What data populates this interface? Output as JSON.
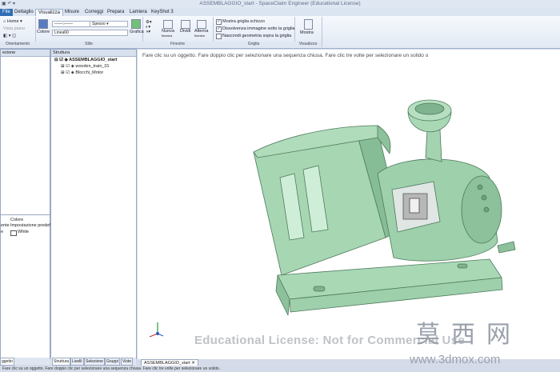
{
  "window": {
    "title": "ASSEMBLAGGIO_start - SpaceClaim Engineer (Educational License)"
  },
  "tabs": [
    "File",
    "Dettaglio",
    "Visualizza",
    "Misure",
    "Correggi",
    "Prepara",
    "Lamiera",
    "KeyShot 3"
  ],
  "ribbon": {
    "orientamento": {
      "label": "Orientamento",
      "home": "Home",
      "vista_piano": "Vista piano"
    },
    "stile": {
      "label": "Stile",
      "colore": "Colore",
      "spesso": "Spesso",
      "linea": "Linea60",
      "grafica": "Grafica"
    },
    "finestre": {
      "label": "Finestre",
      "nuova": "Nuova",
      "nuova_sub": "finestra",
      "dividi": "Dividi",
      "alterna": "Alterna",
      "alterna_sub": "finestre"
    },
    "griglia": {
      "label": "Griglia",
      "opt1": "Mostra griglia schizzo",
      "opt2": "Dissolvenza immagine sotto la griglia",
      "opt3": "Nascondi geometria sopra la griglia"
    },
    "visualizza": {
      "label": "Visualizza",
      "mostra": "Mostra"
    }
  },
  "left_panel": {
    "title": "ezione",
    "props": {
      "col": "Colore",
      "row1_key": "ente",
      "row1_val": "Impostazione predef.",
      "row2_key": "e",
      "row2_val": "White"
    }
  },
  "struttura": {
    "title": "Struttura",
    "root": "ASSEMBLAGGIO_start",
    "items": [
      "wooden_train_01",
      "Blocchi_Motor"
    ]
  },
  "bottom_tabs": [
    "Struttura",
    "Livelli",
    "Selezione",
    "Gruppi",
    "Viste"
  ],
  "left_bottom_tab": "ggetto",
  "doc_tab": "ASSEMBLAGGIO_start",
  "viewport": {
    "prompt": "Fare clic su un oggetto. Fare doppio clic per selezionare una sequenza chiusa. Fare clic tre volte per selezionare un solido o"
  },
  "watermark": {
    "license": "Educational License: Not for Commercial Use",
    "cn": "莫西网",
    "url": "www.3dmox.com"
  },
  "statusbar": {
    "text": "Fare clic su un oggetto. Fare doppio clic per selezionare una sequenza chiusa. Fare clic tre volte per selezionare un solido."
  },
  "colors": {
    "model": "#9ed0ab",
    "model_edge": "#4e7a5c",
    "ribbon_bg": "#e2e9f4"
  }
}
